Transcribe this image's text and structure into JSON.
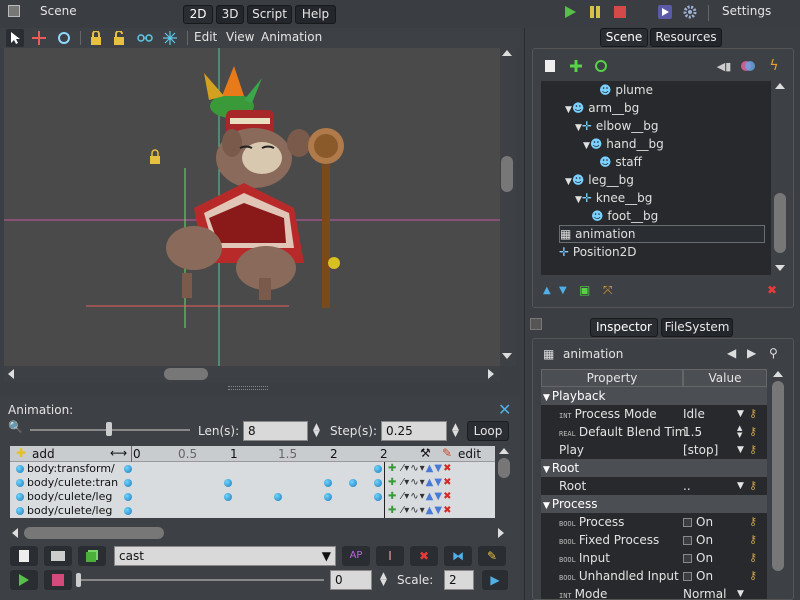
{
  "window": {
    "title": "Scene",
    "settings_label": "Settings"
  },
  "main_tabs": [
    "2D",
    "3D",
    "Script",
    "Help"
  ],
  "viewport_menu": {
    "edit": "Edit",
    "view": "View",
    "animation": "Animation"
  },
  "dock_tabs": {
    "scene": "Scene",
    "resources": "Resources",
    "inspector": "Inspector",
    "filesystem": "FileSystem"
  },
  "scene_tree": [
    {
      "label": "plume",
      "indent": 4,
      "icon": "skeleton-icon"
    },
    {
      "label": "arm__bg",
      "indent": 2,
      "icon": "skeleton-icon",
      "arrow": true
    },
    {
      "label": "elbow__bg",
      "indent": 3,
      "icon": "position-icon",
      "arrow": true
    },
    {
      "label": "hand__bg",
      "indent": 4,
      "icon": "skeleton-icon",
      "arrow": true
    },
    {
      "label": "staff",
      "indent": 5,
      "icon": "skeleton-icon"
    },
    {
      "label": "leg__bg",
      "indent": 2,
      "icon": "skeleton-icon",
      "arrow": true
    },
    {
      "label": "knee__bg",
      "indent": 3,
      "icon": "position-icon",
      "arrow": true
    },
    {
      "label": "foot__bg",
      "indent": 4,
      "icon": "skeleton-icon"
    },
    {
      "label": "animation",
      "indent": 0,
      "icon": "animation-player-icon",
      "selected": true
    },
    {
      "label": "Position2D",
      "indent": 0,
      "icon": "position-icon"
    }
  ],
  "inspector": {
    "node_name": "animation",
    "header_property": "Property",
    "header_value": "Value",
    "rows": [
      {
        "type": "section",
        "label": "Playback"
      },
      {
        "type": "prop",
        "tag": "INT",
        "label": "Process Mode",
        "value": "Idle",
        "control": "dropdown"
      },
      {
        "type": "prop",
        "tag": "REAL",
        "label": "Default Blend Tim",
        "value": "1.5",
        "control": "spin"
      },
      {
        "type": "prop",
        "tag": "",
        "label": "Play",
        "value": "[stop]",
        "control": "dropdown"
      },
      {
        "type": "section",
        "label": "Root"
      },
      {
        "type": "prop",
        "tag": "",
        "label": "Root",
        "value": "..",
        "control": "dropdown"
      },
      {
        "type": "section",
        "label": "Process"
      },
      {
        "type": "prop",
        "tag": "BOOL",
        "label": "Process",
        "value": "On",
        "control": "check"
      },
      {
        "type": "prop",
        "tag": "BOOL",
        "label": "Fixed Process",
        "value": "On",
        "control": "check"
      },
      {
        "type": "prop",
        "tag": "BOOL",
        "label": "Input",
        "value": "On",
        "control": "check"
      },
      {
        "type": "prop",
        "tag": "BOOL",
        "label": "Unhandled Input",
        "value": "On",
        "control": "check"
      },
      {
        "type": "prop",
        "tag": "INT",
        "label": "Mode",
        "value": "Normal",
        "control": "dropdown"
      }
    ]
  },
  "animation_panel": {
    "title": "Animation:",
    "len_label": "Len(s):",
    "len_value": "8",
    "step_label": "Step(s):",
    "step_value": "0.25",
    "loop_label": "Loop",
    "add_label": "add",
    "edit_label": "edit",
    "ruler": [
      "0",
      "0.5",
      "1",
      "1.5",
      "2",
      "2"
    ],
    "tracks": [
      "body:transform/",
      "body/culete:tran",
      "body/culete/leg",
      "body/culete/leg"
    ],
    "animation_name": "cast",
    "time_value": "0",
    "scale_label": "Scale:",
    "scale_value": "2"
  },
  "colors": {
    "accent": "#4fb0e8",
    "play": "#58c04a",
    "pause": "#d4c24a",
    "stop": "#d44a4a",
    "viewport_bg": "#4a4a4a"
  }
}
